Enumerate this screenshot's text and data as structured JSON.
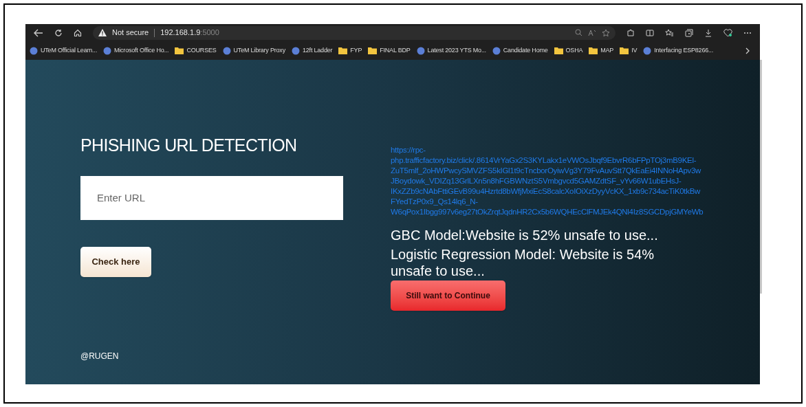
{
  "browser": {
    "security": "Not secure",
    "address_host": "192.168.1.9",
    "address_port": ":5000"
  },
  "bookmarks": [
    {
      "kind": "app",
      "label": "UTeM Official Learn..."
    },
    {
      "kind": "app",
      "label": "Microsoft Office Ho..."
    },
    {
      "kind": "folder",
      "label": "COURSES"
    },
    {
      "kind": "app",
      "label": "UTeM Library Proxy"
    },
    {
      "kind": "app",
      "label": "12ft Ladder"
    },
    {
      "kind": "folder",
      "label": "FYP"
    },
    {
      "kind": "folder",
      "label": "FINAL BDP"
    },
    {
      "kind": "app",
      "label": "Latest 2023 YTS Mo..."
    },
    {
      "kind": "app",
      "label": "Candidate Home"
    },
    {
      "kind": "folder",
      "label": "OSHA"
    },
    {
      "kind": "folder",
      "label": "MAP"
    },
    {
      "kind": "folder",
      "label": "IV"
    },
    {
      "kind": "app",
      "label": "Interfacing ESP8266..."
    }
  ],
  "page": {
    "title": "PHISHING URL DETECTION",
    "url_field": {
      "placeholder": "Enter URL"
    },
    "check_button": "Check here",
    "footer": "@RUGEN",
    "result_url_lines": [
      "https://rpc-",
      "php.trafficfactory.biz/click/.8614VrYaGx2S3KYLakx1eVWOsJbqf9EbvrR6bFPpTOj3mB9KEl-",
      "ZuT5mlf_2oHWPwcySMVZFS5kIGl1t9cTncborOyiwVg3Y79FvAuvStt7QkEaEi4INNoHApv3w",
      "JBoydowk_VDIZq13GrlLXn5n8hFGBWNztS5Vmbgvcd5GAMZdtSF_vYv66W1ubEHsJ-",
      "IKxZZb9cNAbFttiGEvB99u4Hzrtd8bWfjMxiEcS8calcXoIOiXzDyyVcKX_1xb9c734acTiK0tkBw",
      "FYedTzP0x9_Qs14lq6_N-",
      "W6qPox1Ibgg997v6eg27tOkZrqtJqdnHR2Cx5b6WQHEcClFMJEk4QNl4Iz8SGCDpjGMYeWb"
    ],
    "results": [
      "GBC Model:Website is 52% unsafe to use...",
      "Logistic Regression Model: Website is 54% unsafe to use..."
    ],
    "continue_button": "Still want to Continue"
  }
}
